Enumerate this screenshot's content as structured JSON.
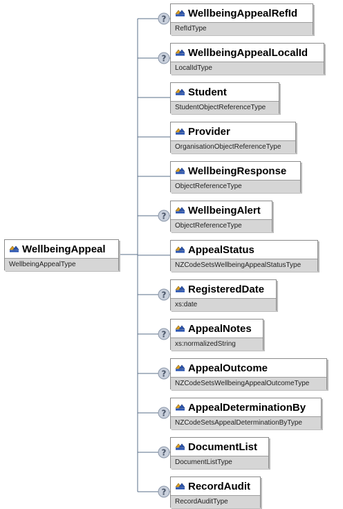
{
  "root": {
    "name": "WellbeingAppeal",
    "type": "WellbeingAppealType"
  },
  "children": [
    {
      "name": "WellbeingAppealRefId",
      "type": "RefIdType",
      "optional": true
    },
    {
      "name": "WellbeingAppealLocalId",
      "type": "LocalIdType",
      "optional": true
    },
    {
      "name": "Student",
      "type": "StudentObjectReferenceType",
      "optional": false
    },
    {
      "name": "Provider",
      "type": "OrganisationObjectReferenceType",
      "optional": false
    },
    {
      "name": "WellbeingResponse",
      "type": "ObjectReferenceType",
      "optional": false
    },
    {
      "name": "WellbeingAlert",
      "type": "ObjectReferenceType",
      "optional": true
    },
    {
      "name": "AppealStatus",
      "type": "NZCodeSetsWellbeingAppealStatusType",
      "optional": false
    },
    {
      "name": "RegisteredDate",
      "type": "xs:date",
      "optional": true
    },
    {
      "name": "AppealNotes",
      "type": "xs:normalizedString",
      "optional": true
    },
    {
      "name": "AppealOutcome",
      "type": "NZCodeSetsWellbeingAppealOutcomeType",
      "optional": true
    },
    {
      "name": "AppealDeterminationBy",
      "type": "NZCodeSetsAppealDeterminationByType",
      "optional": true
    },
    {
      "name": "DocumentList",
      "type": "DocumentListType",
      "optional": true
    },
    {
      "name": "RecordAudit",
      "type": "RecordAuditType",
      "optional": true
    }
  ],
  "colors": {
    "connector": "#5a6f8a",
    "icon_blue": "#2b55b0",
    "icon_gold": "#e0a020",
    "optional_marker": "#8a96a8"
  },
  "icons": {
    "element": "element-icon",
    "optional": "optional-marker-icon"
  }
}
